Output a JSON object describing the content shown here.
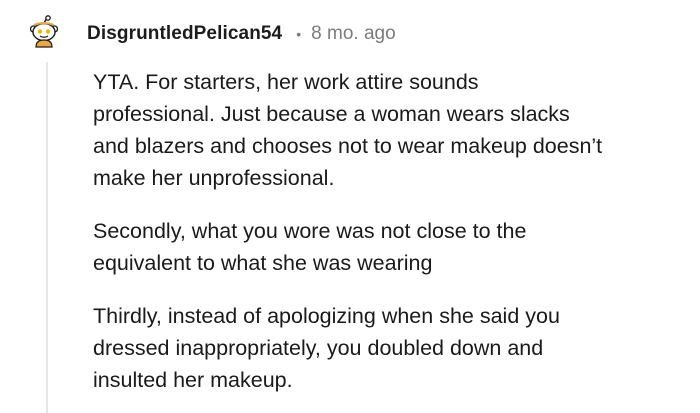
{
  "comment": {
    "username": "DisgruntledPelican54",
    "separator": "•",
    "time_ago": "8 mo. ago",
    "avatar_icon": "snoo-avatar-icon",
    "paragraphs": [
      {
        "lines": [
          "YTA. For starters, her work attire sounds",
          "professional. Just because a woman wears slacks",
          "and blazers and chooses not to wear makeup doesn’t",
          "make her unprofessional."
        ]
      },
      {
        "lines": [
          "Secondly, what you wore was not close to the",
          "equivalent to what she was wearing"
        ]
      },
      {
        "lines": [
          "Thirdly, instead of apologizing when she said you",
          "dressed inappropriately, you doubled down and",
          "insulted her makeup."
        ]
      }
    ]
  }
}
